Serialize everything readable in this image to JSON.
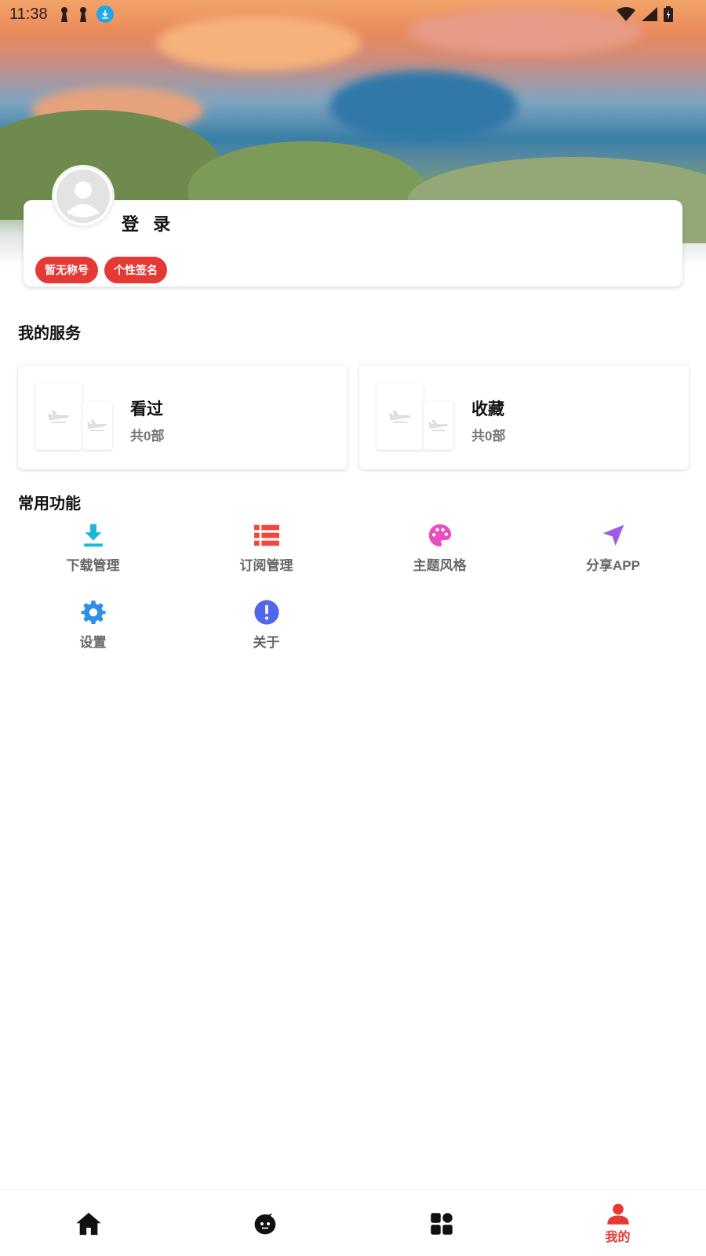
{
  "status_bar": {
    "time": "11:38"
  },
  "profile": {
    "login_label": "登 录",
    "badges": [
      "暂无称号",
      "个性签名"
    ]
  },
  "services": {
    "title": "我的服务",
    "cards": [
      {
        "title": "看过",
        "count": "共0部"
      },
      {
        "title": "收藏",
        "count": "共0部"
      }
    ]
  },
  "features": {
    "title": "常用功能",
    "items": [
      {
        "label": "下载管理",
        "icon": "download-icon",
        "color": "#1ab8d6"
      },
      {
        "label": "订阅管理",
        "icon": "list-icon",
        "color": "#f0473e"
      },
      {
        "label": "主题风格",
        "icon": "palette-icon",
        "color": "#e94fc1"
      },
      {
        "label": "分享APP",
        "icon": "send-icon",
        "color": "#9b5de5"
      },
      {
        "label": "设置",
        "icon": "gear-icon",
        "color": "#2f8fe8"
      },
      {
        "label": "关于",
        "icon": "info-icon",
        "color": "#4f67e8"
      }
    ]
  },
  "bottom_nav": {
    "items": [
      {
        "icon": "home-icon",
        "label": ""
      },
      {
        "icon": "mascot-icon",
        "label": ""
      },
      {
        "icon": "grid-icon",
        "label": ""
      },
      {
        "icon": "user-icon",
        "label": "我的"
      }
    ],
    "active_color": "#e53935"
  }
}
